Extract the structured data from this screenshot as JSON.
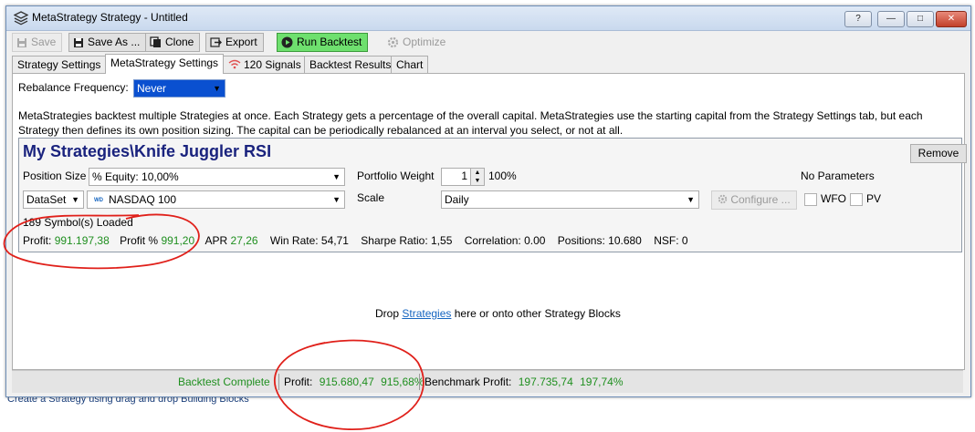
{
  "window": {
    "title": "MetaStrategy Strategy - Untitled",
    "help": "?"
  },
  "toolbar": {
    "save": "Save",
    "save_as": "Save As ...",
    "clone": "Clone",
    "export": "Export",
    "run_backtest": "Run Backtest",
    "optimize": "Optimize"
  },
  "tabs": [
    {
      "label": "Strategy Settings"
    },
    {
      "label": "MetaStrategy Settings"
    },
    {
      "label": "120 Signals"
    },
    {
      "label": "Backtest Results"
    },
    {
      "label": "Chart"
    }
  ],
  "rebalance": {
    "label": "Rebalance Frequency:",
    "value": "Never"
  },
  "description": "MetaStrategies backtest multiple Strategies at once. Each Strategy gets a percentage of the overall capital. MetaStrategies use the starting capital from the Strategy Settings tab, but each Strategy then defines its own position sizing. The capital can be periodically rebalanced at an interval you select, or not at all.",
  "strategy_block": {
    "title": "My Strategies\\Knife Juggler RSI",
    "remove": "Remove",
    "position_size_label": "Position Size",
    "position_size_value": "% Equity: 10,00%",
    "portfolio_weight_label": "Portfolio Weight",
    "portfolio_weight_value": "1",
    "portfolio_weight_pct": "100%",
    "no_parameters": "No Parameters",
    "dataset_label": "DataSet",
    "dataset_badge": "WD",
    "dataset_value": "NASDAQ 100",
    "scale_label": "Scale",
    "scale_value": "Daily",
    "configure": "Configure ...",
    "wfo": "WFO",
    "pv": "PV",
    "symbols_loaded": "189 Symbol(s) Loaded",
    "stats": {
      "profit_label": "Profit:",
      "profit_value": "991.197,38",
      "profit_pct_label": "Profit %",
      "profit_pct_value": "991,20",
      "apr_label": "APR",
      "apr_value": "27,26",
      "win_rate": "Win Rate: 54,71",
      "sharpe": "Sharpe Ratio: 1,55",
      "correlation": "Correlation: 0.00",
      "positions": "Positions: 10.680",
      "nsf": "NSF: 0"
    }
  },
  "drop": {
    "prefix": "Drop",
    "link": "Strategies",
    "suffix": "here or onto other Strategy Blocks"
  },
  "status": {
    "complete": "Backtest Complete",
    "profit_label": "Profit:",
    "profit_value": "915.680,47",
    "profit_pct": "915,68%",
    "benchmark_label": "Benchmark Profit:",
    "benchmark_value": "197.735,74",
    "benchmark_pct": "197,74%"
  },
  "background_text": "Create a Strategy using drag and drop Building Blocks",
  "colors": {
    "profit_green": "#1f8f1f",
    "run_button": "#6ee06e",
    "title_navy": "#1a237e",
    "selection_blue": "#0a50d0",
    "annotation_red": "#e0201a"
  }
}
